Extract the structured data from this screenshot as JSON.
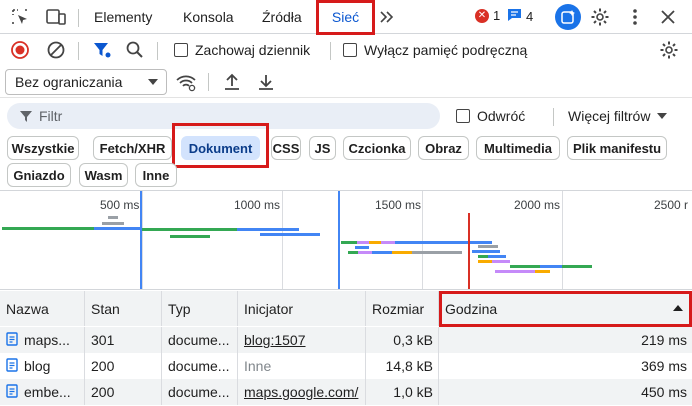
{
  "tabs": [
    {
      "label": "Elementy"
    },
    {
      "label": "Konsola"
    },
    {
      "label": "Źródła"
    },
    {
      "label": "Sieć",
      "active": true
    }
  ],
  "badges": {
    "errors": "1",
    "messages": "4"
  },
  "toolbar": {
    "preserve_log": "Zachowaj dziennik",
    "disable_cache": "Wyłącz pamięć podręczną",
    "throttling": "Bez ograniczania"
  },
  "filter": {
    "placeholder": "Filtr",
    "invert": "Odwróć",
    "more_filters": "Więcej filtrów"
  },
  "chips": [
    "Wszystkie",
    "Fetch/XHR",
    "Dokument",
    "CSS",
    "JS",
    "Czcionka",
    "Obraz",
    "Multimedia",
    "Plik manifestu",
    "Gniazdo",
    "Wasm",
    "Inne"
  ],
  "active_chip": "Dokument",
  "timeline": {
    "ticks": [
      "500 ms",
      "1000 ms",
      "1500 ms",
      "2000 ms",
      "2500 r"
    ],
    "colors": {
      "dom_loaded": "#1a73e8",
      "load": "#d93025",
      "network_green": "#34a853",
      "network_blue": "#4285f4",
      "network_purple": "#c58af9",
      "network_yellow": "#f9ab00",
      "network_gray": "#9aa0a6"
    }
  },
  "table": {
    "headers": [
      "Nazwa",
      "Stan",
      "Typ",
      "Inicjator",
      "Rozmiar",
      "Godzina"
    ],
    "sort": "ascending",
    "rows": [
      {
        "name": "maps...",
        "status": "301",
        "type": "docume...",
        "initiator": "blog:1507",
        "initiator_link": true,
        "size": "0,3 kB",
        "time": "219 ms"
      },
      {
        "name": "blog",
        "status": "200",
        "type": "docume...",
        "initiator": "Inne",
        "initiator_link": false,
        "size": "14,8 kB",
        "time": "369 ms"
      },
      {
        "name": "embe...",
        "status": "200",
        "type": "docume...",
        "initiator": "maps.google.com/",
        "initiator_link": true,
        "size": "1,0 kB",
        "time": "450 ms"
      }
    ]
  }
}
